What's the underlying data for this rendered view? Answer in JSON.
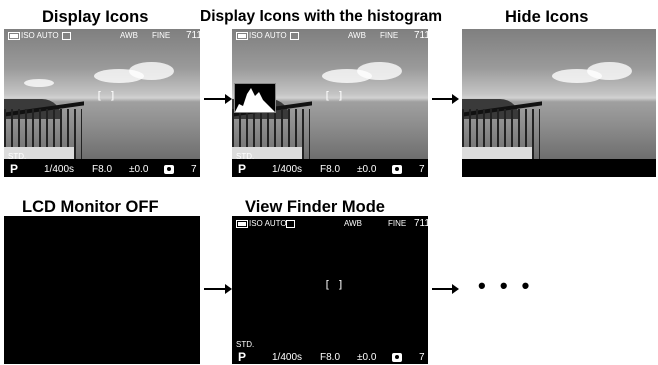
{
  "titles": {
    "display_icons": "Display Icons",
    "display_icons_histogram": "Display Icons with the histogram",
    "hide_icons": "Hide Icons",
    "lcd_off": "LCD Monitor OFF",
    "view_finder": "View Finder Mode"
  },
  "osd": {
    "iso": "ISO AUTO",
    "wb": "AWB",
    "quality": "FINE",
    "shots": "711",
    "style": "STD.",
    "mode": "P",
    "shutter": "1/400s",
    "aperture": "F8.0",
    "exposure": "±0.0",
    "flash_count": "7",
    "af_frame": "[ ]"
  },
  "more": "• • •",
  "icons": [
    "battery-icon",
    "flash-off-icon",
    "gear-icon",
    "histogram-icon",
    "arrow-right-icon"
  ],
  "colors": {
    "background": "#ffffff",
    "screen_bar": "#000000",
    "text": "#000000"
  }
}
